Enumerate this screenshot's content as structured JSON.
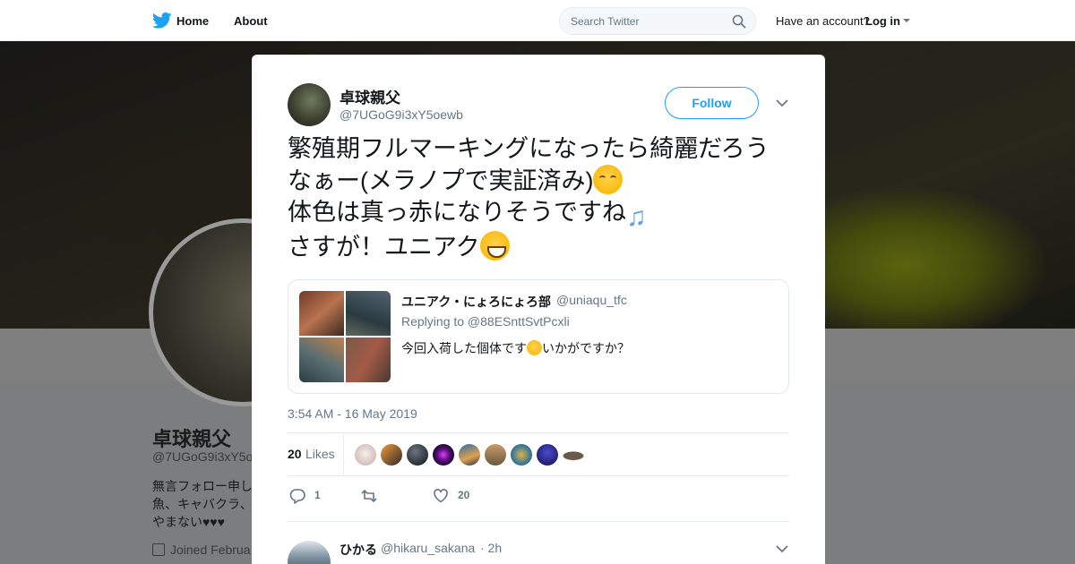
{
  "nav": {
    "home": "Home",
    "about": "About",
    "search_placeholder": "Search Twitter",
    "have_account": "Have an account?",
    "login": "Log in"
  },
  "background_profile": {
    "name": "卓球親父",
    "handle": "@7UGoG9i3xY5o",
    "bio": "無言フォロー申し\n魚、キャバクラ、\nやまない♥♥♥",
    "joined": "Joined Februa"
  },
  "tweet": {
    "author_name": "卓球親父",
    "author_handle": "@7UGoG9i3xY5oewb",
    "follow_label": "Follow",
    "text_line1": "繁殖期フルマーキングになったら綺麗だろう",
    "text_line2": "なぁー(メラノプで実証済み)",
    "text_line3": "体色は真っ赤になりそうですね",
    "text_line4": "さすが！ユニアク",
    "timestamp": "3:54 AM - 16 May 2019",
    "likes_count": "20",
    "likes_label": "Likes",
    "reply_count": "1",
    "like_count": "20"
  },
  "quoted_tweet": {
    "name": "ユニアク・にょろにょろ部",
    "handle": "@uniaqu_tfc",
    "replying_to": "Replying to @88ESnttSvtPcxli",
    "text_before_emoji": "今回入荷した個体です",
    "text_after_emoji": "いかがですか？"
  },
  "reply_preview": {
    "name": "ひかる",
    "handle": "@hikaru_sakana",
    "time": "· 2h"
  },
  "colors": {
    "accent": "#1da1f2",
    "like_red": "#e0245e",
    "muted": "#657786"
  }
}
